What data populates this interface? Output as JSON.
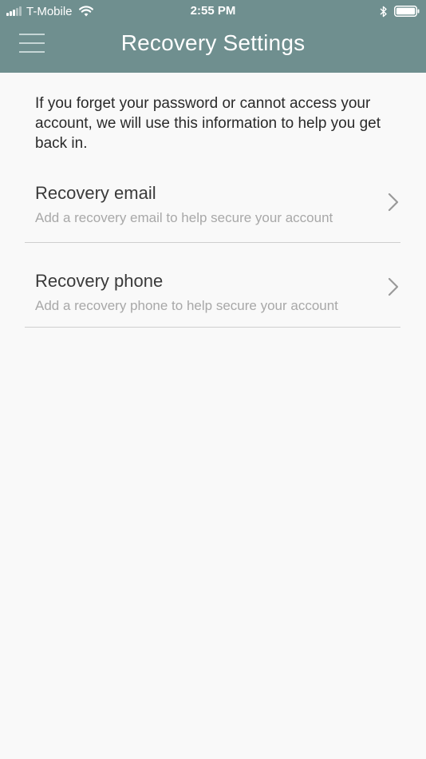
{
  "status_bar": {
    "carrier": "T-Mobile",
    "time": "2:55 PM",
    "icons": [
      "signal-icon",
      "wifi-icon",
      "bluetooth-icon",
      "battery-icon"
    ]
  },
  "header": {
    "title": "Recovery Settings",
    "menu_icon": "hamburger-menu-icon",
    "background_color": "#6f8f8f"
  },
  "intro_text": "If you forget your password or cannot access your account, we will use this information to help you get back in.",
  "options": [
    {
      "title": "Recovery email",
      "subtitle": "Add a recovery email to help secure your account",
      "icon": "chevron-right-icon"
    },
    {
      "title": "Recovery phone",
      "subtitle": "Add a recovery phone to help secure your account",
      "icon": "chevron-right-icon"
    }
  ]
}
